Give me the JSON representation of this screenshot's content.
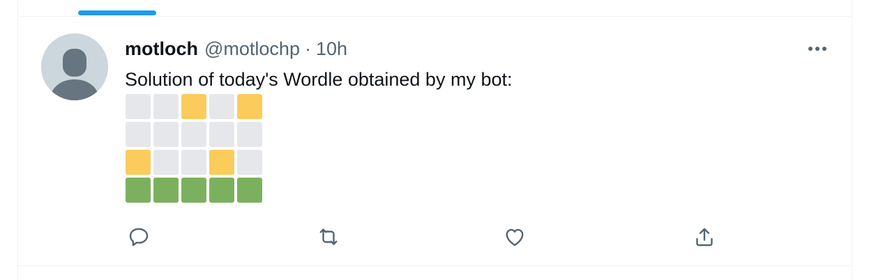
{
  "tweet": {
    "display_name": "motloch",
    "handle": "@motlochp",
    "separator": "·",
    "time": "10h",
    "text": "Solution of today's Wordle obtained by my bot:",
    "more_icon": "more-horizontal-icon",
    "avatar_icon": "default-profile-icon"
  },
  "wordle": {
    "rows": [
      [
        "gray",
        "gray",
        "yellow",
        "gray",
        "yellow"
      ],
      [
        "gray",
        "gray",
        "gray",
        "gray",
        "gray"
      ],
      [
        "yellow",
        "gray",
        "gray",
        "yellow",
        "gray"
      ],
      [
        "green",
        "green",
        "green",
        "green",
        "green"
      ]
    ],
    "colors": {
      "gray": "#e5e7ea",
      "yellow": "#fbcb5c",
      "green": "#7bb15e"
    }
  },
  "actions": [
    {
      "name": "reply",
      "icon": "reply-icon"
    },
    {
      "name": "retweet",
      "icon": "retweet-icon"
    },
    {
      "name": "like",
      "icon": "heart-icon"
    },
    {
      "name": "share",
      "icon": "share-icon"
    }
  ],
  "colors": {
    "accent": "#1d9bf0",
    "text_primary": "#0f1419",
    "text_secondary": "#536471",
    "avatar_bg": "#ccd6dd",
    "avatar_fg": "#66757f"
  }
}
